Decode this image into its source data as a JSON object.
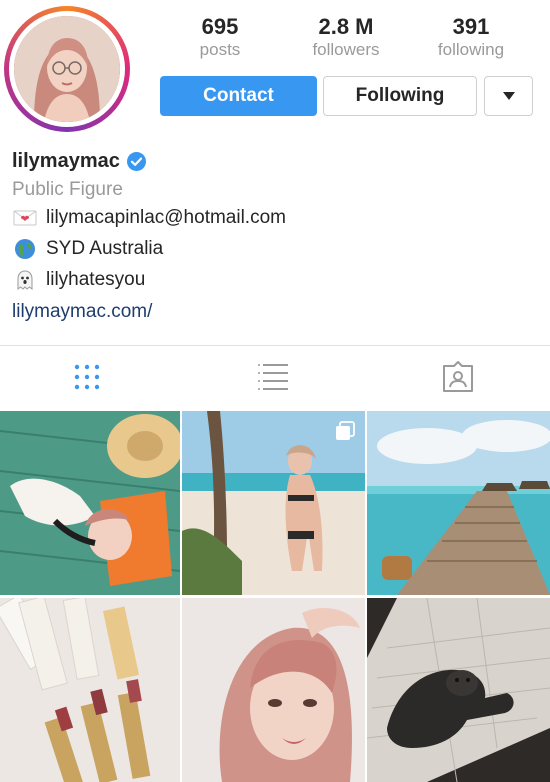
{
  "profile": {
    "username": "lilymaymac",
    "category": "Public Figure",
    "bio": [
      {
        "icon": "love-letter-icon",
        "text": "lilymacapinlac@hotmail.com"
      },
      {
        "icon": "globe-icon",
        "text": "SYD Australia"
      },
      {
        "icon": "ghost-icon",
        "text": "lilyhatesyou"
      }
    ],
    "website": "lilymaymac.com/"
  },
  "stats": {
    "posts": {
      "value": "695",
      "label": "posts"
    },
    "followers": {
      "value": "2.8 M",
      "label": "followers"
    },
    "following": {
      "value": "391",
      "label": "following"
    }
  },
  "buttons": {
    "contact": "Contact",
    "following": "Following"
  },
  "tabs": [
    {
      "name": "grid-view",
      "icon": "grid-icon",
      "active": true
    },
    {
      "name": "list-view",
      "icon": "list-icon",
      "active": false
    },
    {
      "name": "tagged",
      "icon": "tagged-icon",
      "active": false
    }
  ],
  "grid": [
    {
      "subject": "lounging with sun hat on green blanket",
      "multi": false
    },
    {
      "subject": "beach with palm tree",
      "multi": true
    },
    {
      "subject": "wooden boardwalk to overwater villas",
      "multi": false
    },
    {
      "subject": "lipsticks and makeup products",
      "multi": false
    },
    {
      "subject": "selfie close-up",
      "multi": false
    },
    {
      "subject": "pug on patterned rug",
      "multi": false
    }
  ],
  "colors": {
    "accent": "#3897f0",
    "text": "#262626",
    "muted": "#9a9a9a",
    "link": "#1f3d6b",
    "divider": "#e2e2e2"
  }
}
